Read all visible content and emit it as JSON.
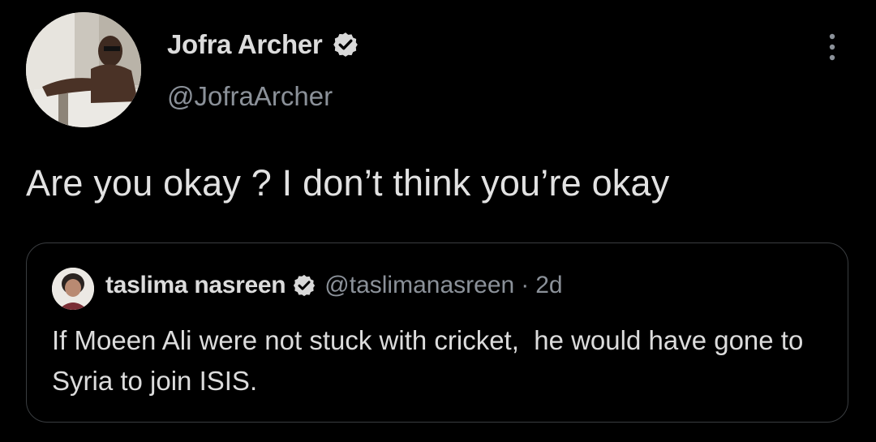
{
  "tweet": {
    "author": {
      "name": "Jofra Archer",
      "handle": "@JofraArcher",
      "verified": true,
      "avatar_icon": "profile-photo"
    },
    "text": "Are you okay ? I don’t think you’re okay",
    "menu_icon": "more-vertical-icon"
  },
  "quote": {
    "author": {
      "name": "taslima nasreen",
      "handle": "@taslimanasreen",
      "verified": true,
      "avatar_icon": "profile-photo"
    },
    "separator": "·",
    "time": "2d",
    "text": "If Moeen Ali were not stuck with cricket,  he would have gone to Syria to join ISIS."
  },
  "colors": {
    "background": "#000000",
    "text_primary": "#dcdcdc",
    "text_secondary": "#8b9199",
    "border": "#3a3d40",
    "verified_badge": "#d9d9d9"
  }
}
